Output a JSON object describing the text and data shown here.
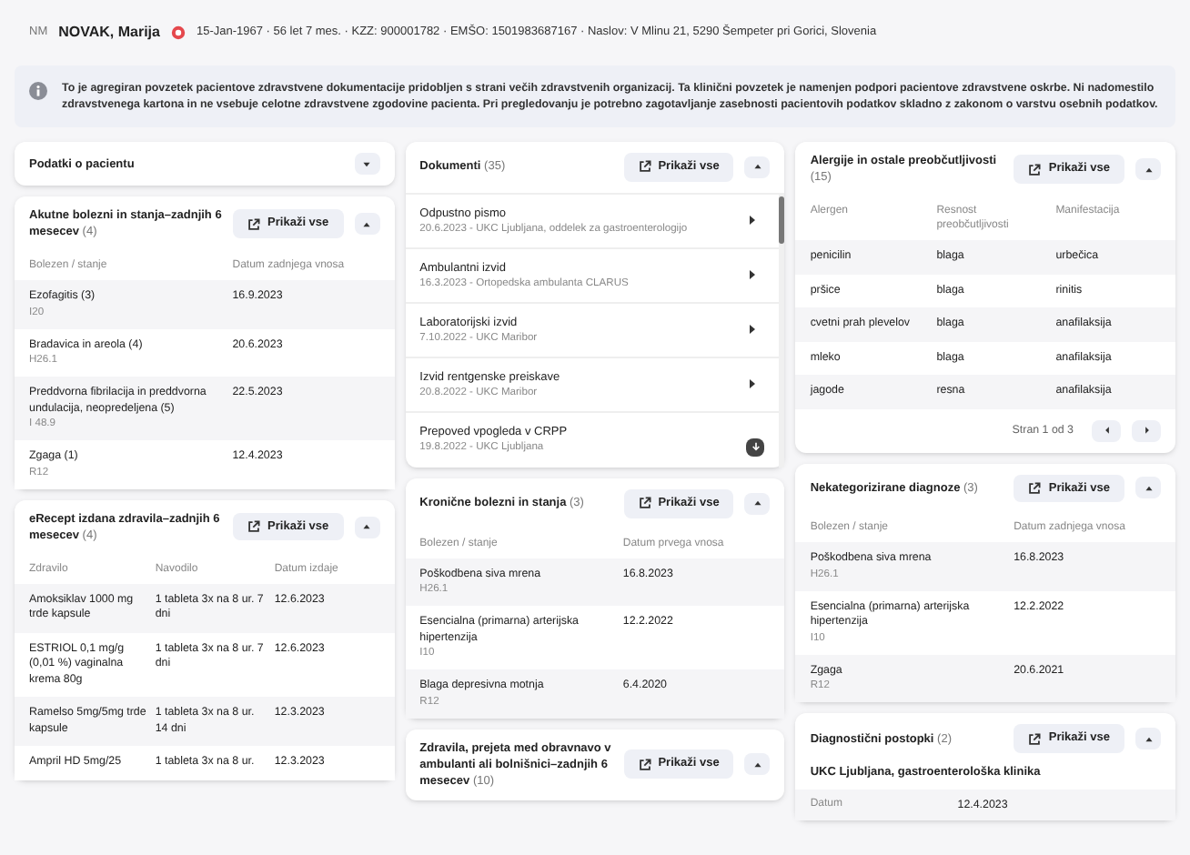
{
  "patient": {
    "initials": "NM",
    "name": "NOVAK, Marija",
    "flagged": true,
    "details": "15-Jan-1967 · 56 let 7 mes. · KZZ: 900001782 · EMŠO: 1501983687167 · Naslov: V Mlinu 21, 5290 Šempeter pri Gorici, Slovenia"
  },
  "notice": "To je agregiran povzetek pacientove zdravstvene dokumentacije pridobljen s strani večih zdravstvenih organizacij. Ta klinični povzetek je namenjen podpori pacientove zdravstvene oskrbe. Ni nadomestilo zdravstvenega kartona in ne vsebuje celotne zdravstvene zgodovine pacienta. Pri pregledovanju je potrebno zagotavljanje zasebnosti pacientovih podatkov skladno z zakonom o varstvu osebnih podatkov.",
  "columns": [
    [
      {
        "kind": "header",
        "title": "Podatki o pacientu",
        "expanded": false
      },
      {
        "kind": "table",
        "title": "Akutne bolezni in stanja–zadnjih 6 mesecev",
        "count": "(4)",
        "show_all": "Prikaži vse",
        "expanded": true,
        "headers": [
          "Bolezen / stanje",
          "Datum zadnjega vnosa"
        ],
        "rows": [
          [
            {
              "text": "Ezofagitis (3)",
              "sub": "I20"
            },
            {
              "text": "16.9.2023"
            }
          ],
          [
            {
              "text": "Bradavica in areola (4)",
              "sub": "H26.1"
            },
            {
              "text": "20.6.2023"
            }
          ],
          [
            {
              "text": "Preddvorna fibrilacija in preddvorna undulacija, neopredeljena (5)",
              "sub": "I 48.9"
            },
            {
              "text": "22.5.2023"
            }
          ],
          [
            {
              "text": "Zgaga (1)",
              "sub": "R12"
            },
            {
              "text": "12.4.2023"
            }
          ]
        ]
      },
      {
        "kind": "table",
        "title": "eRecept izdana zdravila–zadnjih 6 mesecev",
        "count": "(4)",
        "show_all": "Prikaži vse",
        "expanded": true,
        "headers": [
          "Zdravilo",
          "Navodilo",
          "Datum izdaje"
        ],
        "rows": [
          [
            {
              "text": "Amoksiklav 1000 mg trde kapsule"
            },
            {
              "text": "1 tableta 3x na 8 ur. 7 dni"
            },
            {
              "text": "12.6.2023"
            }
          ],
          [
            {
              "text": "ESTRIOL 0,1 mg/g (0,01 %) vaginalna krema 80g"
            },
            {
              "text": "1 tableta 3x na 8 ur. 7 dni"
            },
            {
              "text": "12.6.2023"
            }
          ],
          [
            {
              "text": "Ramelso 5mg/5mg trde kapsule"
            },
            {
              "text": "1 tableta 3x na 8 ur. 14 dni"
            },
            {
              "text": "12.3.2023"
            }
          ],
          [
            {
              "text": "Ampril HD 5mg/25"
            },
            {
              "text": "1 tableta 3x na 8 ur."
            },
            {
              "text": "12.3.2023"
            }
          ]
        ]
      }
    ],
    [
      {
        "kind": "list",
        "title": "Dokumenti",
        "count": "(35)",
        "show_all": "Prikaži vse",
        "expanded": true,
        "items": [
          {
            "title": "Odpustno pismo",
            "sub": "20.6.2023 - UKC Ljubljana, oddelek za gastroenterologijo",
            "kind": "link"
          },
          {
            "title": "Ambulantni izvid",
            "sub": "16.3.2023 - Ortopedska ambulanta CLARUS",
            "kind": "link"
          },
          {
            "title": "Laboratorijski izvid",
            "sub": "7.10.2022 - UKC Maribor",
            "kind": "link"
          },
          {
            "title": "Izvid rentgenske preiskave",
            "sub": "20.8.2022 - UKC Maribor",
            "kind": "link"
          },
          {
            "title": "Prepoved vpogleda v CRPP",
            "sub": "19.8.2022 - UKC Ljubljana",
            "kind": "download"
          }
        ]
      },
      {
        "kind": "table",
        "title": "Kronične bolezni in stanja",
        "count": "(3)",
        "show_all": "Prikaži vse",
        "expanded": true,
        "headers": [
          "Bolezen / stanje",
          "Datum prvega vnosa"
        ],
        "rows": [
          [
            {
              "text": "Poškodbena siva mrena",
              "sub": "H26.1"
            },
            {
              "text": "16.8.2023"
            }
          ],
          [
            {
              "text": "Esencialna (primarna) arterijska hipertenzija",
              "sub": "I10"
            },
            {
              "text": "12.2.2022"
            }
          ],
          [
            {
              "text": "Blaga depresivna motnja",
              "sub": "R12"
            },
            {
              "text": "6.4.2020"
            }
          ]
        ]
      },
      {
        "kind": "header",
        "title": "Zdravila, prejeta med obravnavo v ambulanti ali bolnišnici–zadnjih 6 mesecev",
        "count": "(10)",
        "show_all": "Prikaži vse",
        "expanded": true
      }
    ],
    [
      {
        "kind": "table",
        "title": "Alergije in ostale preobčutljivosti",
        "count": "(15)",
        "show_all": "Prikaži vse",
        "expanded": true,
        "headers": [
          "Alergen",
          "Resnost preobčutljivosti",
          "Manifestacija"
        ],
        "rows": [
          [
            {
              "text": "penicilin"
            },
            {
              "text": "blaga"
            },
            {
              "text": "urbečica"
            }
          ],
          [
            {
              "text": "pršice"
            },
            {
              "text": "blaga"
            },
            {
              "text": "rinitis"
            }
          ],
          [
            {
              "text": "cvetni prah plevelov"
            },
            {
              "text": "blaga"
            },
            {
              "text": "anafilaksija"
            }
          ],
          [
            {
              "text": "mleko"
            },
            {
              "text": "blaga"
            },
            {
              "text": "anafilaksija"
            }
          ],
          [
            {
              "text": "jagode"
            },
            {
              "text": "resna"
            },
            {
              "text": "anafilaksija"
            }
          ]
        ],
        "pager": "Stran 1 od 3"
      },
      {
        "kind": "table",
        "title": "Nekategorizirane diagnoze",
        "count": "(3)",
        "show_all": "Prikaži vse",
        "expanded": true,
        "headers": [
          "Bolezen / stanje",
          "Datum zadnjega vnosa"
        ],
        "rows": [
          [
            {
              "text": "Poškodbena siva mrena",
              "sub": "H26.1"
            },
            {
              "text": "16.8.2023"
            }
          ],
          [
            {
              "text": "Esencialna (primarna) arterijska hipertenzija",
              "sub": "I10"
            },
            {
              "text": "12.2.2022"
            }
          ],
          [
            {
              "text": "Zgaga",
              "sub": "R12"
            },
            {
              "text": "20.6.2021"
            }
          ]
        ]
      },
      {
        "kind": "group",
        "title": "Diagnostični postopki",
        "count": "(2)",
        "show_all": "Prikaži vse",
        "expanded": true,
        "group": "UKC Ljubljana, gastroenterološka klinika",
        "fields": [
          {
            "label": "Datum",
            "value": "12.4.2023"
          }
        ]
      }
    ]
  ]
}
